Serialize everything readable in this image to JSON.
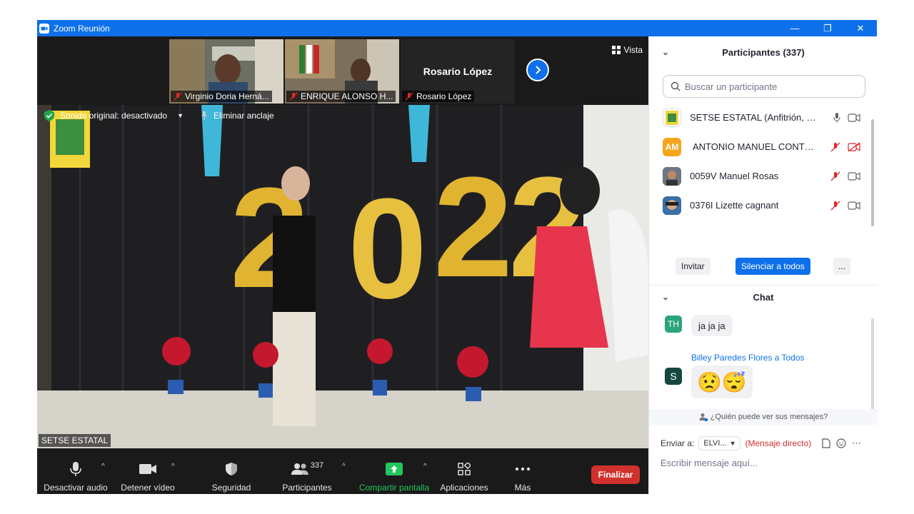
{
  "window": {
    "title": "Zoom Reunión",
    "minimize": "—",
    "restore": "❐",
    "close": "✕"
  },
  "strip": {
    "tiles": [
      {
        "name": "Virginio Doria Herná..."
      },
      {
        "name": "ENRIQUE ALONSO H..."
      },
      {
        "name": "Rosario López",
        "big_name": "Rosario López"
      }
    ],
    "view_label": "Vista"
  },
  "stage": {
    "original_sound": "Sonido original: desactivado",
    "unpin": "Eliminar anclaje",
    "speaker_label": "SETSE ESTATAL"
  },
  "toolbar": {
    "mute": "Desactivar audio",
    "stop_video": "Detener vídeo",
    "security": "Seguridad",
    "participants": "Participantes",
    "participants_count": "337",
    "share": "Compartir pantalla",
    "apps": "Aplicaciones",
    "more": "Más",
    "end": "Finalizar"
  },
  "participants": {
    "header": "Participantes (337)",
    "search_placeholder": "Buscar un participante",
    "rows": [
      {
        "name": "SETSE ESTATAL (Anfitrión, yo)",
        "initials": ""
      },
      {
        "name": "ANTONIO MANUEL CONTRER...",
        "initials": "AM"
      },
      {
        "name": "0059V Manuel Rosas",
        "initials": ""
      },
      {
        "name": "0376I Lizette cagnant",
        "initials": ""
      }
    ],
    "invite": "Invitar",
    "mute_all": "Silenciar a todos",
    "more": "..."
  },
  "chat": {
    "header": "Chat",
    "messages": [
      {
        "initials": "TH",
        "text": "ja ja ja"
      },
      {
        "initials": "S",
        "sender": "Billey Paredes Flores a Todos",
        "text": "😟😴"
      }
    ],
    "who_can_see": "¿Quién puede ver sus mensajes?",
    "send_to_label": "Enviar a:",
    "send_to_value": "ELVI...",
    "direct_message": "(Mensaje directo)",
    "input_placeholder": "Escribir mensaje aquí..."
  },
  "colors": {
    "accent": "#0e71eb",
    "end": "#d1312c",
    "share": "#22c55e"
  }
}
